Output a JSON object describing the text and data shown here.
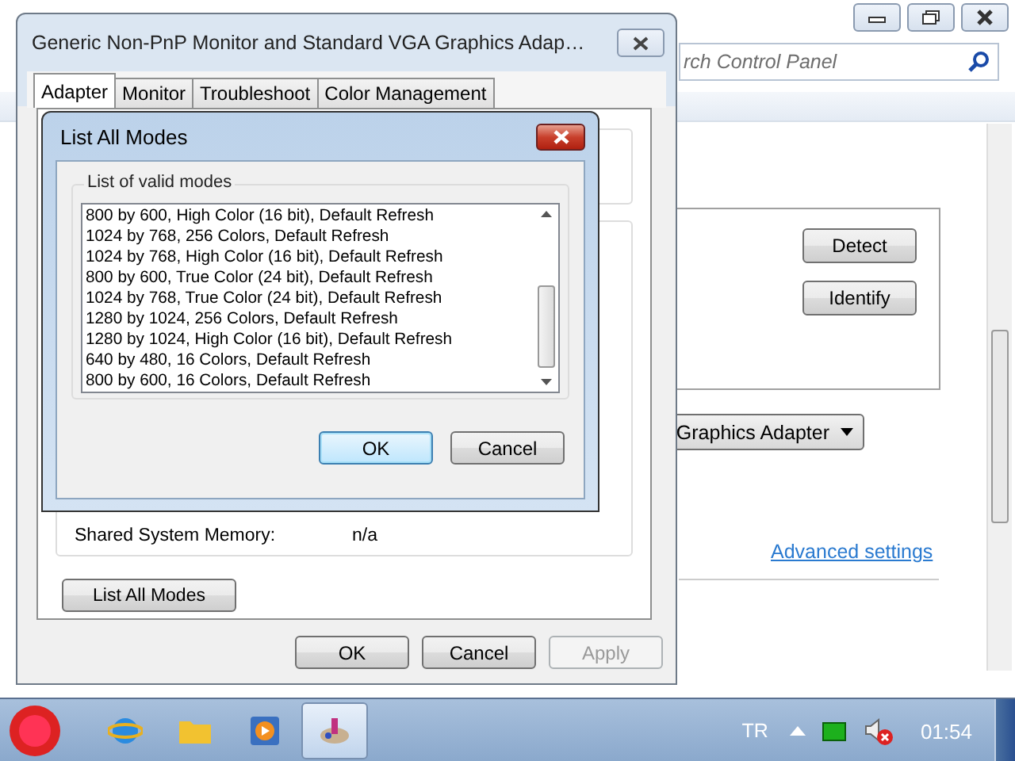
{
  "control_panel": {
    "search": {
      "placeholder": "rch Control Panel"
    },
    "buttons": [
      "Detect",
      "Identify"
    ],
    "dropdown": {
      "value": "Graphics Adapter"
    },
    "link": "Advanced settings"
  },
  "properties_dialog": {
    "title": "Generic Non-PnP Monitor and Standard VGA Graphics Adap…",
    "tabs": [
      {
        "label": "Adapter",
        "selected": true
      },
      {
        "label": "Monitor",
        "selected": false
      },
      {
        "label": "Troubleshoot",
        "selected": false
      },
      {
        "label": "Color Management",
        "selected": false
      }
    ],
    "memory_label": "Shared System Memory:",
    "memory_value": "n/a",
    "list_button": "List All Modes",
    "buttons": [
      {
        "label": "OK",
        "disabled": false
      },
      {
        "label": "Cancel",
        "disabled": false
      },
      {
        "label": "Apply",
        "disabled": true
      }
    ]
  },
  "modes_dialog": {
    "title": "List All Modes",
    "group_label": "List of valid modes",
    "modes": [
      "800 by 600, High Color (16 bit), Default Refresh",
      "1024 by 768, 256 Colors, Default Refresh",
      "1024 by 768, High Color (16 bit), Default Refresh",
      "800 by 600, True Color (24 bit), Default Refresh",
      "1024 by 768, True Color (24 bit), Default Refresh",
      "1280 by 1024, 256 Colors, Default Refresh",
      "1280 by 1024, High Color (16 bit), Default Refresh",
      "640 by 480, 16 Colors, Default Refresh",
      "800 by 600, 16 Colors, Default Refresh"
    ],
    "buttons": [
      {
        "label": "OK",
        "default": true
      },
      {
        "label": "Cancel",
        "default": false
      }
    ]
  },
  "taskbar": {
    "apps": [
      {
        "kind": "browser",
        "selected": false
      },
      {
        "kind": "folder",
        "selected": false
      },
      {
        "kind": "media",
        "selected": false
      },
      {
        "kind": "paint",
        "selected": true
      }
    ],
    "language": "TR",
    "clock": "01:54"
  }
}
